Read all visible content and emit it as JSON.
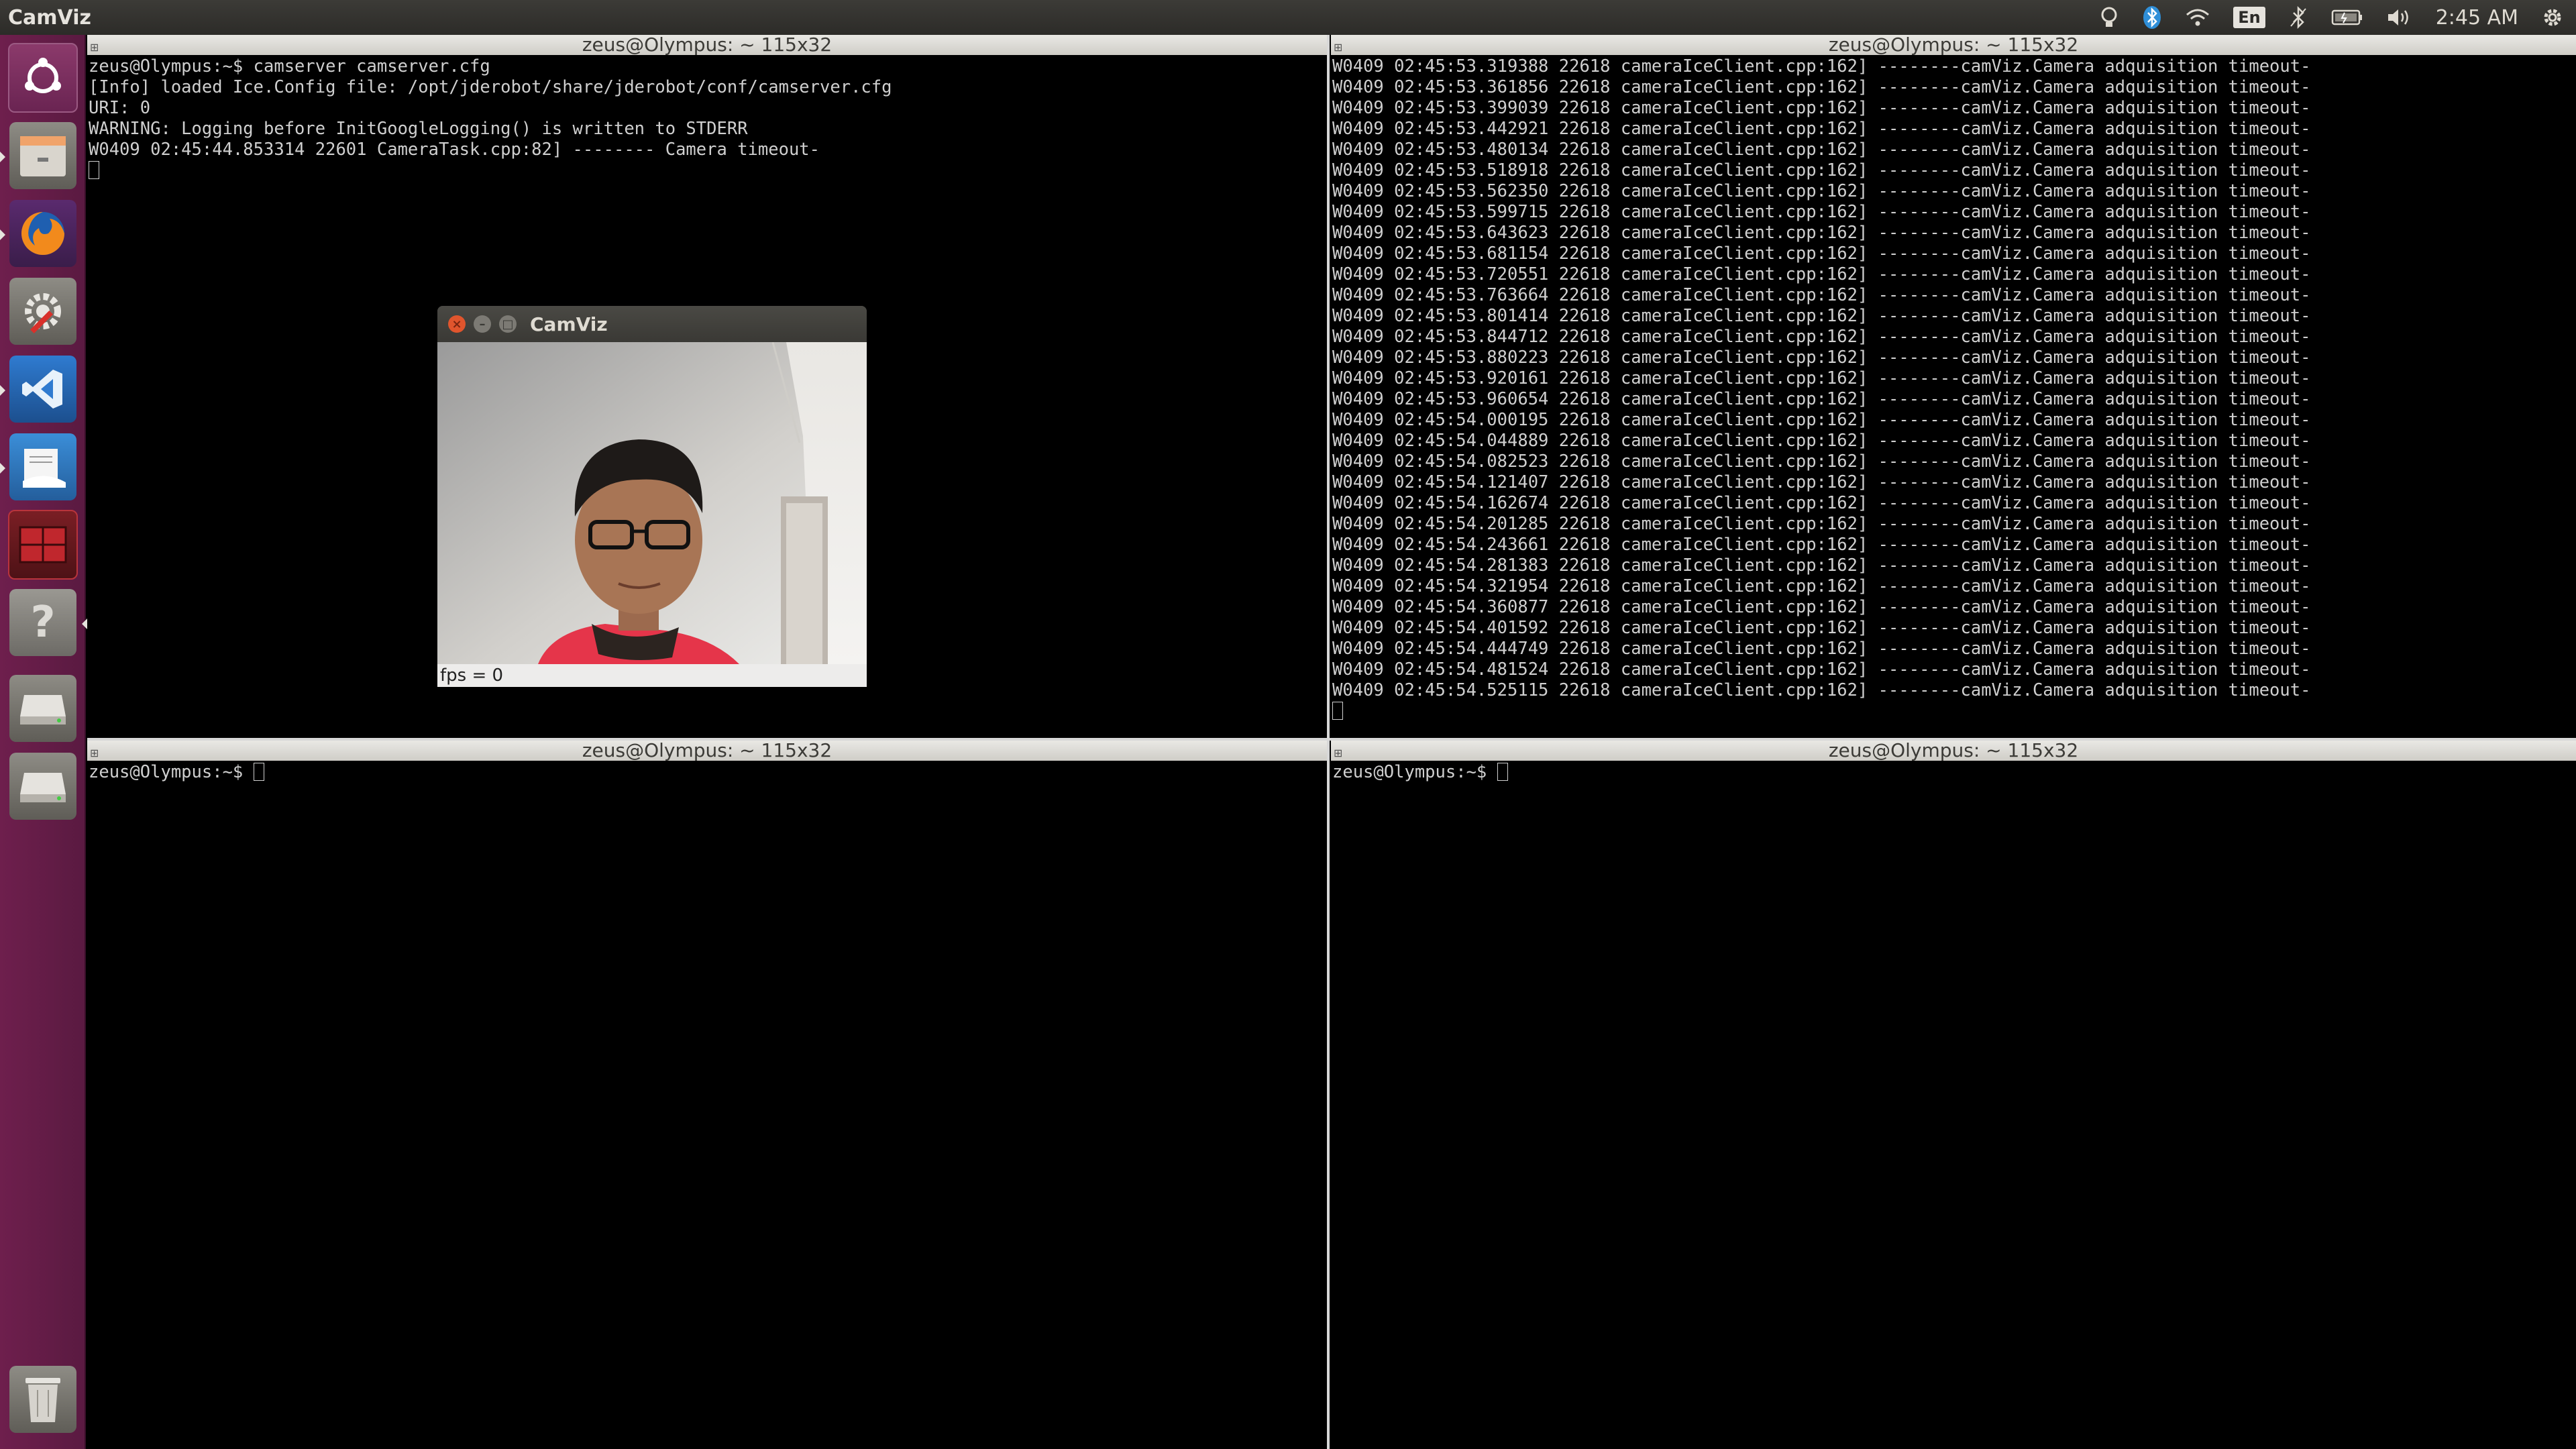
{
  "topbar": {
    "app_name": "CamViz",
    "lang": "En",
    "clock": "2:45 AM"
  },
  "launcher": {
    "items": [
      "ubuntu-dash",
      "files",
      "firefox",
      "system-settings",
      "vscode",
      "text-editor",
      "workspace-switcher",
      "help",
      "drive-1",
      "drive-2",
      "trash"
    ]
  },
  "terminals": {
    "t1": {
      "title": "zeus@Olympus: ~ 115x32",
      "lines": [
        "zeus@Olympus:~$ camserver camserver.cfg",
        "[Info] loaded Ice.Config file: /opt/jderobot/share/jderobot/conf/camserver.cfg",
        "URI: 0",
        "WARNING: Logging before InitGoogleLogging() is written to STDERR",
        "W0409 02:45:44.853314 22601 CameraTask.cpp:82] -------- Camera timeout-"
      ]
    },
    "t2": {
      "title": "zeus@Olympus: ~ 115x32",
      "lines": [
        "W0409 02:45:53.319388 22618 cameraIceClient.cpp:162] --------camViz.Camera adquisition timeout-",
        "W0409 02:45:53.361856 22618 cameraIceClient.cpp:162] --------camViz.Camera adquisition timeout-",
        "W0409 02:45:53.399039 22618 cameraIceClient.cpp:162] --------camViz.Camera adquisition timeout-",
        "W0409 02:45:53.442921 22618 cameraIceClient.cpp:162] --------camViz.Camera adquisition timeout-",
        "W0409 02:45:53.480134 22618 cameraIceClient.cpp:162] --------camViz.Camera adquisition timeout-",
        "W0409 02:45:53.518918 22618 cameraIceClient.cpp:162] --------camViz.Camera adquisition timeout-",
        "W0409 02:45:53.562350 22618 cameraIceClient.cpp:162] --------camViz.Camera adquisition timeout-",
        "W0409 02:45:53.599715 22618 cameraIceClient.cpp:162] --------camViz.Camera adquisition timeout-",
        "W0409 02:45:53.643623 22618 cameraIceClient.cpp:162] --------camViz.Camera adquisition timeout-",
        "W0409 02:45:53.681154 22618 cameraIceClient.cpp:162] --------camViz.Camera adquisition timeout-",
        "W0409 02:45:53.720551 22618 cameraIceClient.cpp:162] --------camViz.Camera adquisition timeout-",
        "W0409 02:45:53.763664 22618 cameraIceClient.cpp:162] --------camViz.Camera adquisition timeout-",
        "W0409 02:45:53.801414 22618 cameraIceClient.cpp:162] --------camViz.Camera adquisition timeout-",
        "W0409 02:45:53.844712 22618 cameraIceClient.cpp:162] --------camViz.Camera adquisition timeout-",
        "W0409 02:45:53.880223 22618 cameraIceClient.cpp:162] --------camViz.Camera adquisition timeout-",
        "W0409 02:45:53.920161 22618 cameraIceClient.cpp:162] --------camViz.Camera adquisition timeout-",
        "W0409 02:45:53.960654 22618 cameraIceClient.cpp:162] --------camViz.Camera adquisition timeout-",
        "W0409 02:45:54.000195 22618 cameraIceClient.cpp:162] --------camViz.Camera adquisition timeout-",
        "W0409 02:45:54.044889 22618 cameraIceClient.cpp:162] --------camViz.Camera adquisition timeout-",
        "W0409 02:45:54.082523 22618 cameraIceClient.cpp:162] --------camViz.Camera adquisition timeout-",
        "W0409 02:45:54.121407 22618 cameraIceClient.cpp:162] --------camViz.Camera adquisition timeout-",
        "W0409 02:45:54.162674 22618 cameraIceClient.cpp:162] --------camViz.Camera adquisition timeout-",
        "W0409 02:45:54.201285 22618 cameraIceClient.cpp:162] --------camViz.Camera adquisition timeout-",
        "W0409 02:45:54.243661 22618 cameraIceClient.cpp:162] --------camViz.Camera adquisition timeout-",
        "W0409 02:45:54.281383 22618 cameraIceClient.cpp:162] --------camViz.Camera adquisition timeout-",
        "W0409 02:45:54.321954 22618 cameraIceClient.cpp:162] --------camViz.Camera adquisition timeout-",
        "W0409 02:45:54.360877 22618 cameraIceClient.cpp:162] --------camViz.Camera adquisition timeout-",
        "W0409 02:45:54.401592 22618 cameraIceClient.cpp:162] --------camViz.Camera adquisition timeout-",
        "W0409 02:45:54.444749 22618 cameraIceClient.cpp:162] --------camViz.Camera adquisition timeout-",
        "W0409 02:45:54.481524 22618 cameraIceClient.cpp:162] --------camViz.Camera adquisition timeout-",
        "W0409 02:45:54.525115 22618 cameraIceClient.cpp:162] --------camViz.Camera adquisition timeout-"
      ]
    },
    "t3": {
      "title": "zeus@Olympus: ~ 115x32",
      "prompt": "zeus@Olympus:~$ "
    },
    "t4": {
      "title": "zeus@Olympus: ~ 115x32",
      "prompt": "zeus@Olympus:~$ "
    }
  },
  "camviz": {
    "title": "CamViz",
    "status": "fps = 0"
  },
  "colors": {
    "launcher": "#6e1f4d",
    "terminal_bg": "#000000",
    "terminal_fg": "#cfcfcf",
    "panel": "#3c3b37"
  }
}
